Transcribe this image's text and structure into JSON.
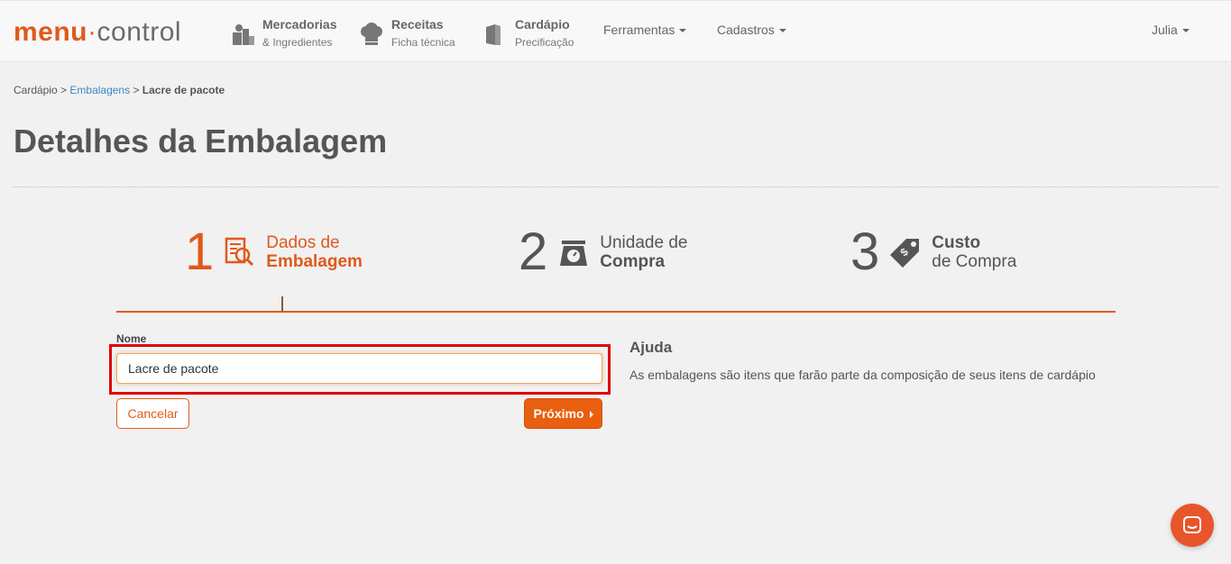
{
  "logo": {
    "part1": "menu",
    "dot": "·",
    "part2": "control"
  },
  "nav": {
    "mercadorias": {
      "title": "Mercadorias",
      "subtitle": "& Ingredientes"
    },
    "receitas": {
      "title": "Receitas",
      "subtitle": "Ficha técnica"
    },
    "cardapio": {
      "title": "Cardápio",
      "subtitle": "Precificação"
    },
    "ferramentas": "Ferramentas",
    "cadastros": "Cadastros",
    "user": "Julia"
  },
  "breadcrumb": {
    "root": "Cardápio",
    "sep1": " > ",
    "link": "Embalagens",
    "sep2": " > ",
    "current": "Lacre de pacote"
  },
  "page_title": "Detalhes da Embalagem",
  "wizard": {
    "step1": {
      "num": "1",
      "line1": "Dados de",
      "line2": "Embalagem"
    },
    "step2": {
      "num": "2",
      "line1": "Unidade de",
      "line2": "Compra"
    },
    "step3": {
      "num": "3",
      "line1": "Custo",
      "line2": "de Compra"
    }
  },
  "form": {
    "nome_label": "Nome",
    "nome_value": "Lacre de pacote",
    "cancel_label": "Cancelar",
    "next_label": "Próximo"
  },
  "help": {
    "title": "Ajuda",
    "text": "As embalagens são itens que farão parte da composição de seus itens de cardápio"
  },
  "colors": {
    "accent": "#e05a1a",
    "link": "#3a87c7",
    "highlight": "#e00000"
  }
}
